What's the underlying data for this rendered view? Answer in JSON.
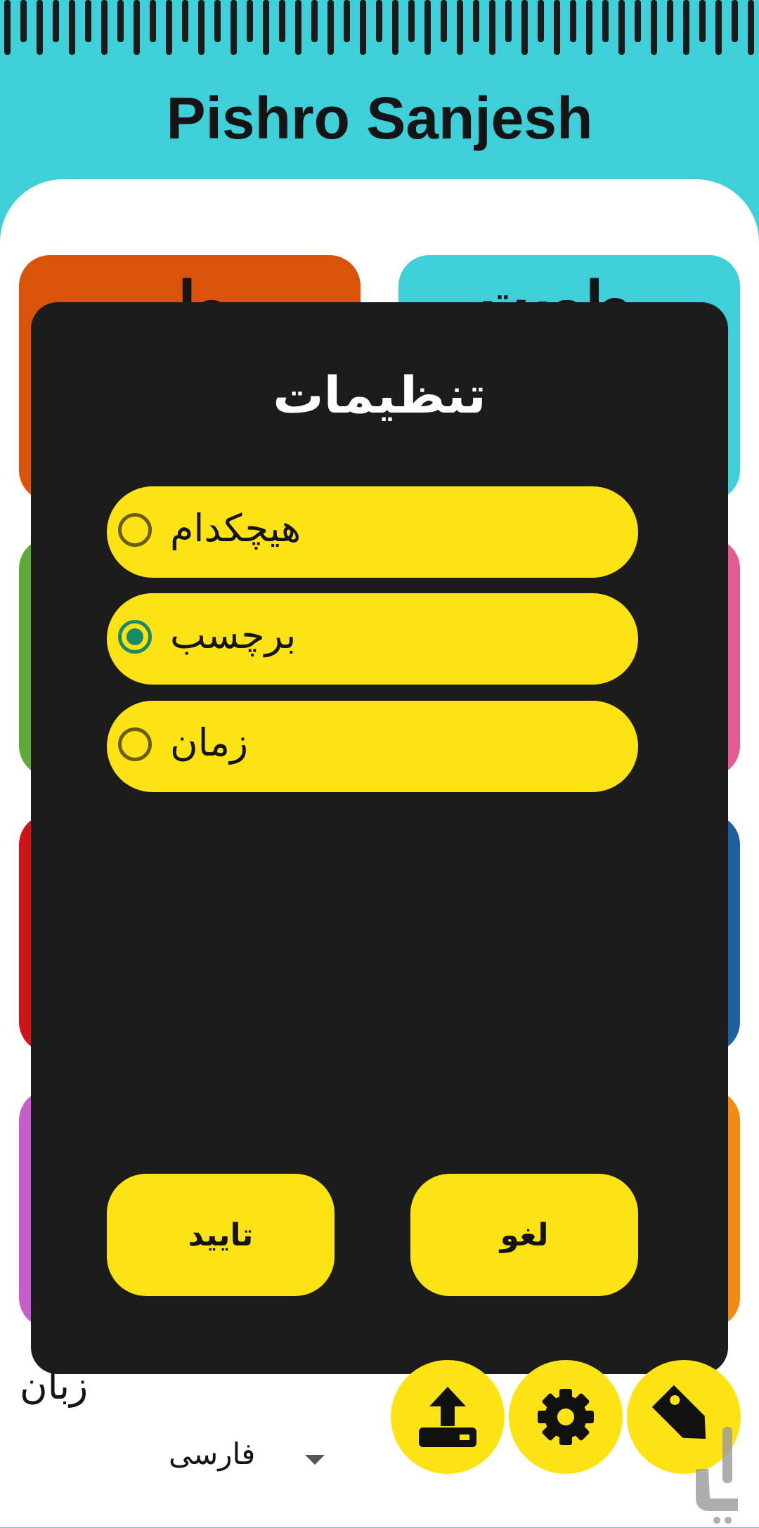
{
  "app": {
    "title": "Pishro Sanjesh"
  },
  "tiles": [
    {
      "name": "tile-orange",
      "color": "#d9530a",
      "label": "ول"
    },
    {
      "name": "tile-cyan",
      "color": "#3ecfd9",
      "label": "رطوبت"
    },
    {
      "name": "tile-green",
      "color": "#5fa83a",
      "label": ""
    },
    {
      "name": "tile-pink",
      "color": "#e35b8f",
      "label": ""
    },
    {
      "name": "tile-red",
      "color": "#cc1515",
      "label": ""
    },
    {
      "name": "tile-blue",
      "color": "#1e5fa0",
      "label": ""
    },
    {
      "name": "tile-purple",
      "color": "#c45fc9",
      "label": ""
    },
    {
      "name": "tile-amber",
      "color": "#f08a10",
      "label": ""
    }
  ],
  "dialog": {
    "title": "تنظیمات",
    "options": [
      {
        "label": "هیچکدام",
        "selected": false
      },
      {
        "label": "برچسب",
        "selected": true
      },
      {
        "label": "زمان",
        "selected": false
      }
    ],
    "confirm_label": "تایید",
    "cancel_label": "لغو"
  },
  "bottom": {
    "language_label": "زبان",
    "language_value": "فارسی",
    "fab_icons": [
      "upload-icon",
      "gear-icon",
      "tag-icon"
    ]
  },
  "colors": {
    "background": "#3ecfd9",
    "dialog": "#1c1c1c",
    "accent": "#fde214",
    "radio_selected": "#1b8a6b"
  }
}
